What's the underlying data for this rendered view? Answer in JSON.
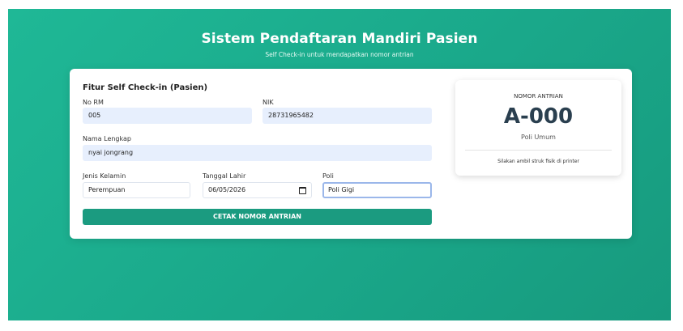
{
  "header": {
    "title": "Sistem Pendaftaran Mandiri Pasien",
    "subtitle": "Self Check-in untuk mendapatkan nomor antrian"
  },
  "form": {
    "title": "Fitur Self Check-in (Pasien)",
    "no_rm": {
      "label": "No RM",
      "value": "005"
    },
    "nik": {
      "label": "NIK",
      "value": "28731965482"
    },
    "nama": {
      "label": "Nama Lengkap",
      "value": "nyai jongrang"
    },
    "jenis_kelamin": {
      "label": "Jenis Kelamin",
      "value": "Perempuan"
    },
    "tanggal_lahir": {
      "label": "Tanggal Lahir",
      "value": "06/05/2026",
      "icon": "calendar-icon"
    },
    "poli": {
      "label": "Poli",
      "value": "Poli Gigi"
    },
    "submit_label": "CETAK NOMOR ANTRIAN"
  },
  "queue": {
    "label": "NOMOR ANTRIAN",
    "number": "A-000",
    "poli": "Poli Umum",
    "note": "Silakan ambil struk fisik di printer"
  },
  "colors": {
    "background_gradient_start": "#1fb896",
    "background_gradient_end": "#179a7e",
    "button": "#1b9b80",
    "filled_input": "#e7effd",
    "focus_border": "#9bb7ea"
  }
}
